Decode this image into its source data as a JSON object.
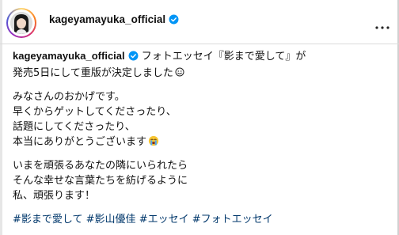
{
  "header": {
    "username": "kageyamayuka_official"
  },
  "caption": {
    "username": "kageyamayuka_official",
    "lines": [
      "フォトエッセイ『影まで愛して』が",
      "発売5日にして重版が決定しました",
      "みなさんのおかげです。",
      "早くからゲットしてくださったり、",
      "話題にしてくださったり、",
      "本当にありがとうございます",
      "いまを頑張るあなたの隣にいられたら",
      "そんな幸せな言葉たちを紡げるように",
      "私、頑張ります！"
    ],
    "hashtags": [
      "#影まで愛して",
      "#影山優佳",
      "#エッセイ",
      "#フォトエッセイ"
    ]
  },
  "icons": {
    "verified": "verified-badge-icon",
    "more": "more-options-icon",
    "smile": "smiling-face-icon",
    "cry": "crying-face-icon"
  },
  "colors": {
    "verified": "#0095f6",
    "hashtag": "#00376b",
    "divider": "#dbdbdb"
  }
}
